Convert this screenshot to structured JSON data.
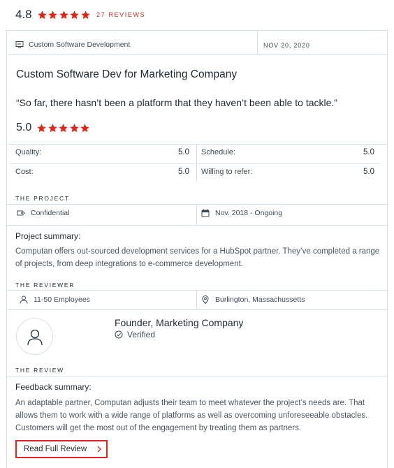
{
  "summary": {
    "overall_rating": "4.8",
    "stars_filled": 5,
    "reviews_label": "27 REVIEWS"
  },
  "review": {
    "service_icon": "presentation-icon",
    "service": "Custom Software Development",
    "date": "NOV 20, 2020",
    "title": "Custom Software Dev for Marketing Company",
    "quote": "“So far, there hasn’t been a platform that they haven’t been able to tackle.”",
    "rating": "5.0",
    "stars_filled": 5,
    "metrics": {
      "quality_label": "Quality:",
      "quality_value": "5.0",
      "schedule_label": "Schedule:",
      "schedule_value": "5.0",
      "cost_label": "Cost:",
      "cost_value": "5.0",
      "refer_label": "Willing to refer:",
      "refer_value": "5.0"
    }
  },
  "project": {
    "section_label": "THE PROJECT",
    "budget_icon": "tag-icon",
    "budget": "Confidential",
    "dates_icon": "calendar-icon",
    "dates": "Nov. 2018 - Ongoing",
    "summary_heading": "Project summary:",
    "summary_text": "Computan offers out-sourced development services for a HubSpot partner. They’ve completed a range of projects, from deep integrations to e-commerce development."
  },
  "reviewer": {
    "section_label": "THE REVIEWER",
    "size_icon": "user-icon",
    "company_size": "11-50 Employees",
    "location_icon": "location-pin-icon",
    "location": "Burlington, Massachussetts",
    "name_title": "Founder, Marketing Company",
    "verified_label": "Verified"
  },
  "review_section": {
    "section_label": "THE REVIEW",
    "feedback_heading": "Feedback summary:",
    "feedback_text": "An adaptable partner, Computan adjusts their team to meet whatever the project’s needs are. That allows them to work with a wide range of platforms as well as overcoming unforeseeable obstacles. Customers will get the most out of the engagement by treating them as partners.",
    "read_more_label": "Read Full Review"
  },
  "colors": {
    "accent_red": "#e62415",
    "text_dark": "#1f2a33",
    "border": "#d5e1ea"
  }
}
